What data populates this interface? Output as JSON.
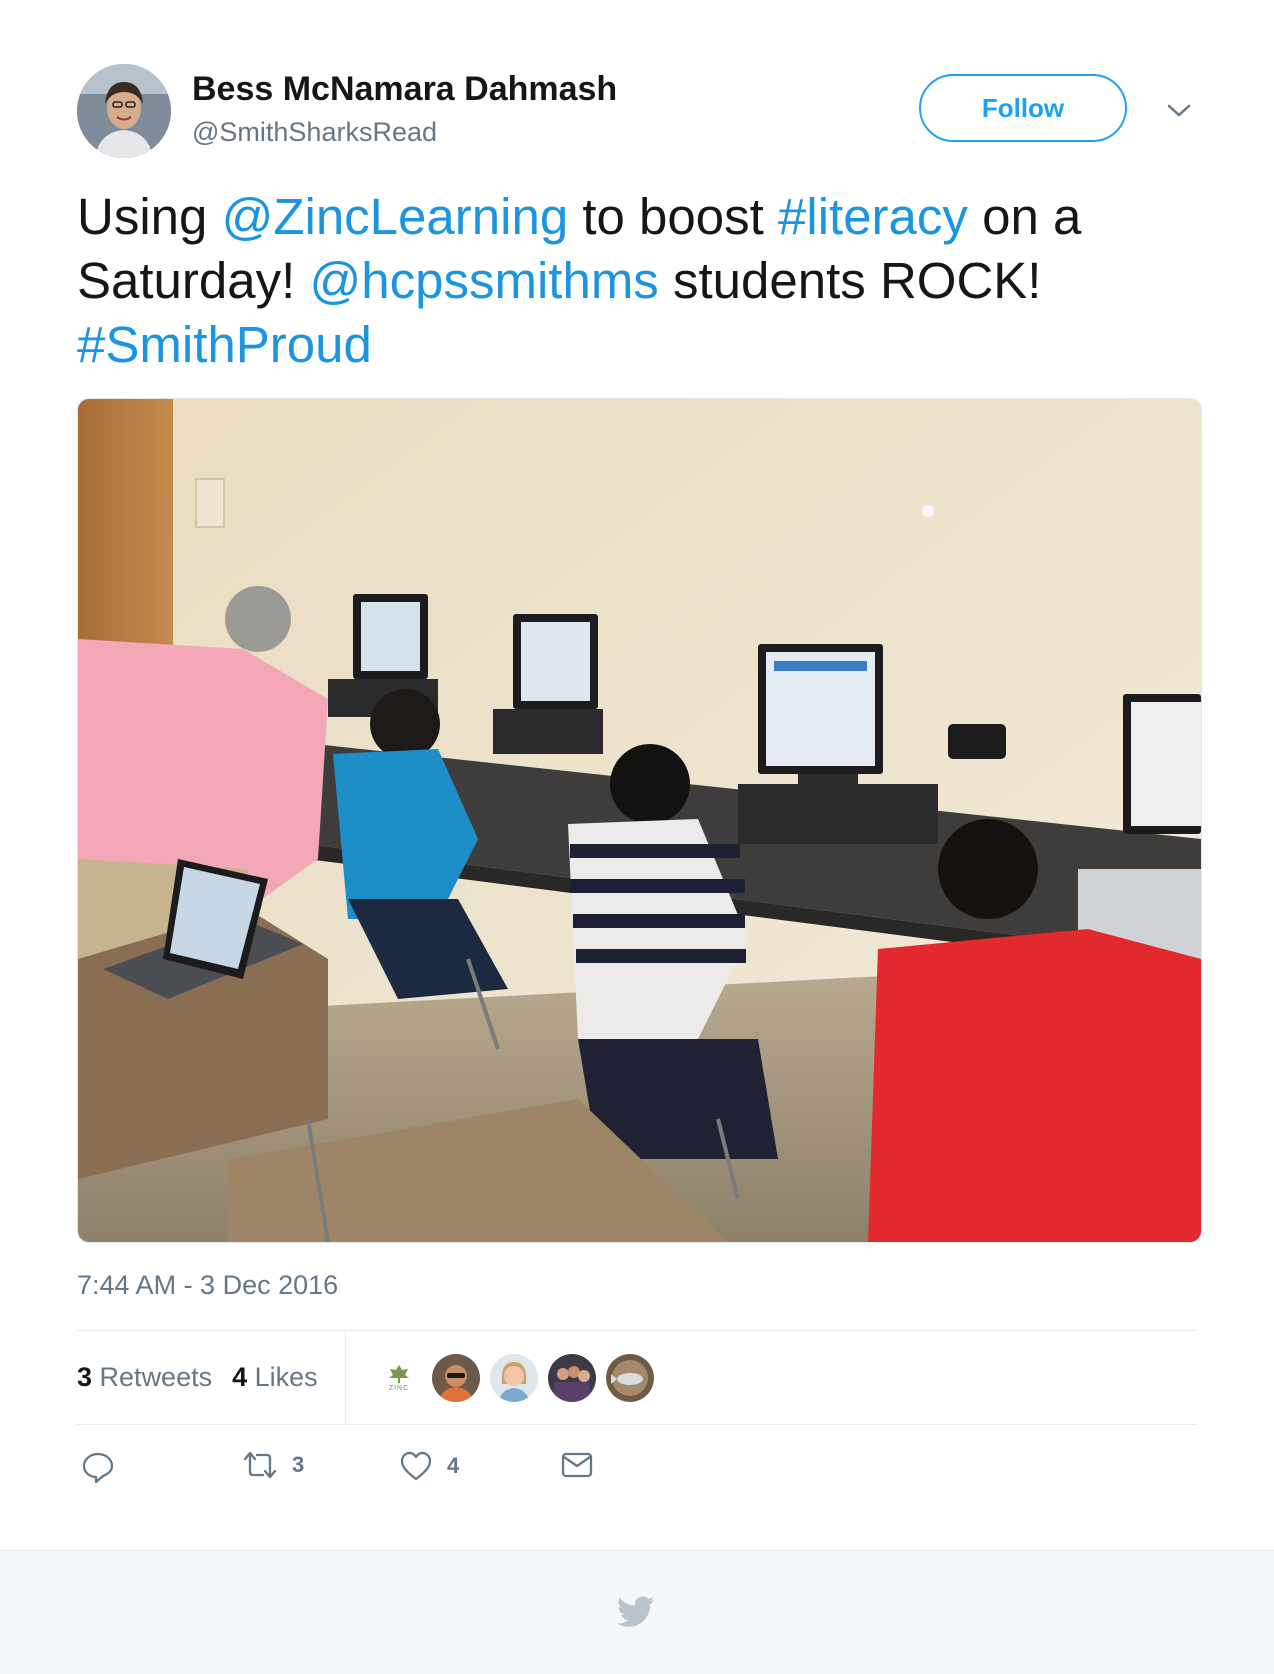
{
  "author": {
    "name": "Bess McNamara Dahmash",
    "handle": "@SmithSharksRead"
  },
  "follow_label": "Follow",
  "tweet": {
    "w1": "Using ",
    "mention1": "@ZincLearning",
    "w2": " to boost ",
    "hashtag1": "#literacy",
    "w3": " on a Saturday! ",
    "mention2": "@hcpssmithms",
    "w4": " students ROCK! ",
    "hashtag2": "#SmithProud"
  },
  "timestamp": "7:44 AM - 3 Dec 2016",
  "stats": {
    "retweets_count": "3",
    "retweets_label": "Retweets",
    "likes_count": "4",
    "likes_label": "Likes"
  },
  "likers": {
    "zinc_text": "ZINC"
  },
  "actions": {
    "retweet_count": "3",
    "like_count": "4"
  },
  "colors": {
    "link": "#1b95e0",
    "follow": "#1da1f2",
    "secondary_text": "#657786",
    "footer_bg": "#f5f8fa"
  },
  "icons": [
    "chevron-down-icon",
    "reply-icon",
    "retweet-icon",
    "heart-icon",
    "message-icon",
    "twitter-bird-icon"
  ]
}
